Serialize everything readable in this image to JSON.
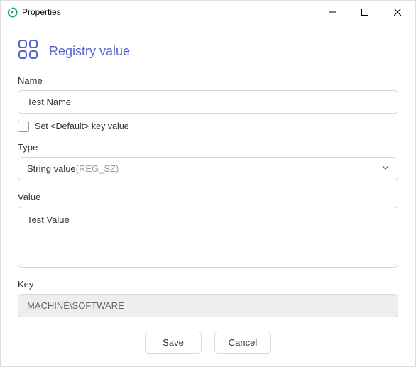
{
  "window": {
    "title": "Properties"
  },
  "header": {
    "title": "Registry value"
  },
  "fields": {
    "name_label": "Name",
    "name_value": "Test Name",
    "set_default_label": "Set <Default> key value",
    "type_label": "Type",
    "type_value": "String value ",
    "type_hint": "(REG_SZ)",
    "value_label": "Value",
    "value_value": "Test Value",
    "key_label": "Key",
    "key_value": "MACHINE\\SOFTWARE"
  },
  "buttons": {
    "save": "Save",
    "cancel": "Cancel"
  }
}
